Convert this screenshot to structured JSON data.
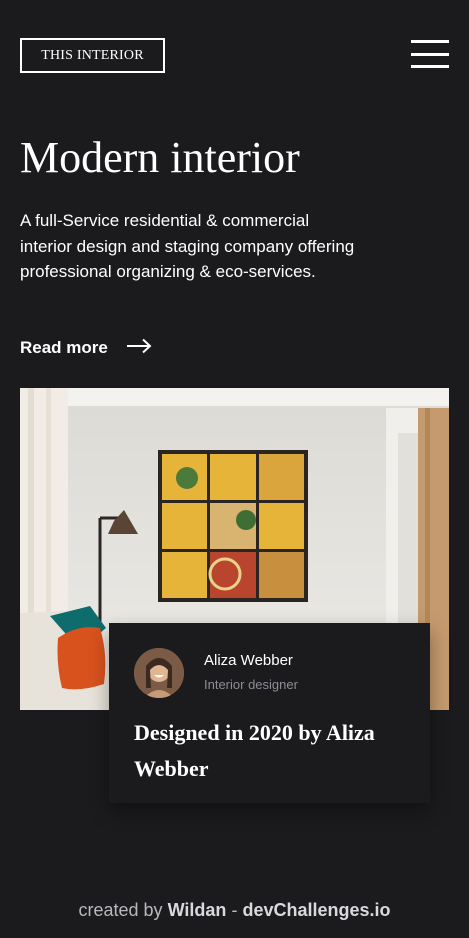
{
  "header": {
    "logo_text": "THIS INTERIOR"
  },
  "hero": {
    "title": "Modern interior",
    "description": "A full-Service residential & commercial interior design and staging company offering professional organizing & eco-services.",
    "read_more_label": "Read more"
  },
  "card": {
    "author_name": "Aliza Webber",
    "author_role": "Interior designer",
    "heading": "Designed in 2020 by Aliza Webber"
  },
  "footer": {
    "prefix": "created by",
    "author": "Wildan",
    "separator": "-",
    "site": "devChallenges.io"
  },
  "colors": {
    "background": "#1b1a1c",
    "text": "#ffffff",
    "muted": "#8e8d96"
  }
}
